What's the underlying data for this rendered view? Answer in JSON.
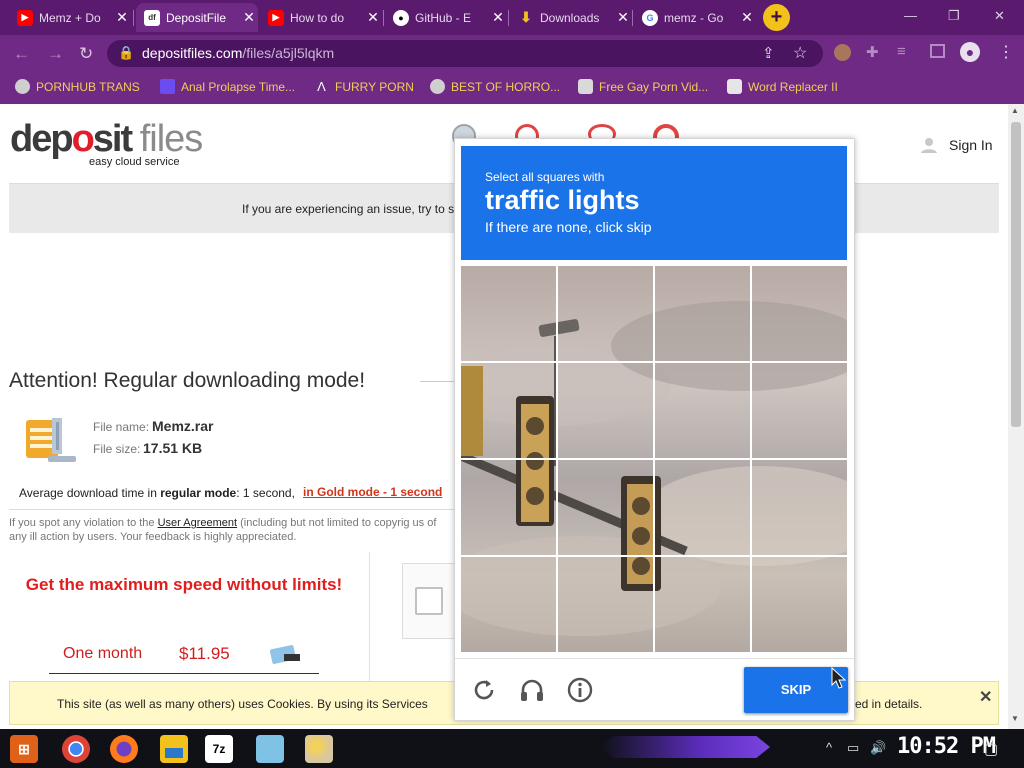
{
  "browser": {
    "tabs": [
      {
        "title": "Memz + Do",
        "icon": "youtube-icon",
        "color": "#ff0000",
        "active": false
      },
      {
        "title": "DepositFile",
        "icon": "depositfiles-icon",
        "color": "#ffffff",
        "active": true
      },
      {
        "title": "How to do",
        "icon": "youtube-icon",
        "color": "#ff0000",
        "active": false
      },
      {
        "title": "GitHub - E",
        "icon": "github-icon",
        "color": "#000000",
        "active": false
      },
      {
        "title": "Downloads",
        "icon": "download-icon",
        "color": "#f2c21b",
        "active": false
      },
      {
        "title": "memz - Go",
        "icon": "google-icon",
        "color": "#4285f4",
        "active": false
      }
    ],
    "close_glyph": "✕",
    "new_tab_glyph": "+",
    "url_host": "depositfiles.com",
    "url_path": "/files/a5jl5lqkm",
    "bookmarks": [
      "PORNHUB TRANS",
      "Anal Prolapse Time...",
      "FURRY PORN",
      "BEST OF HORRO...",
      "Free Gay Porn Vid...",
      "Word Replacer II"
    ],
    "theme_colors": {
      "tabbar": "#5a1a6e",
      "toolbar": "#6f2a86",
      "bookmark_text": "#f2cc5a"
    }
  },
  "page": {
    "logo": {
      "dep": "dep",
      "o": "o",
      "sit": "sit",
      "files": "files"
    },
    "tagline": "easy cloud service",
    "sign_in": "Sign In",
    "notice": "If you are experiencing an issue, try to s",
    "attention": "Attention! Regular downloading mode!",
    "file_name_label": "File name:",
    "file_name": "Memz.rar",
    "file_size_label": "File size:",
    "file_size": "17.51 KB",
    "avg_prefix": "Average download time in ",
    "avg_mode": "regular mode",
    "avg_suffix": ": 1 second, ",
    "gold_link": "in Gold mode - 1 second",
    "violation_pre": "If you spot any violation to the ",
    "violation_link": "User Agreement",
    "violation_post": " (including but not limited to copyrig us of any ill action by users. Your feedback is highly appreciated.",
    "get_max": "Get the maximum speed without limits!",
    "plan_period": "One month",
    "plan_price": "$11.95",
    "cookie_left": "This site (as well as many others) uses Cookies. By using its Services",
    "cookie_right": "ed in details.",
    "cookie_close": "✕"
  },
  "captcha": {
    "instruction": "Select all squares with",
    "object": "traffic lights",
    "hint": "If there are none, click skip",
    "skip_label": "SKIP",
    "accent": "#1a73e8",
    "footer_icons": [
      "refresh-icon",
      "audio-challenge-icon",
      "info-icon"
    ]
  },
  "taskbar": {
    "clock": "10:52 PM",
    "pinned": [
      "start-icon",
      "chrome-icon",
      "firefox-icon",
      "file-explorer-icon",
      "7zip-icon",
      "notepad-icon",
      "paint-icon"
    ]
  }
}
